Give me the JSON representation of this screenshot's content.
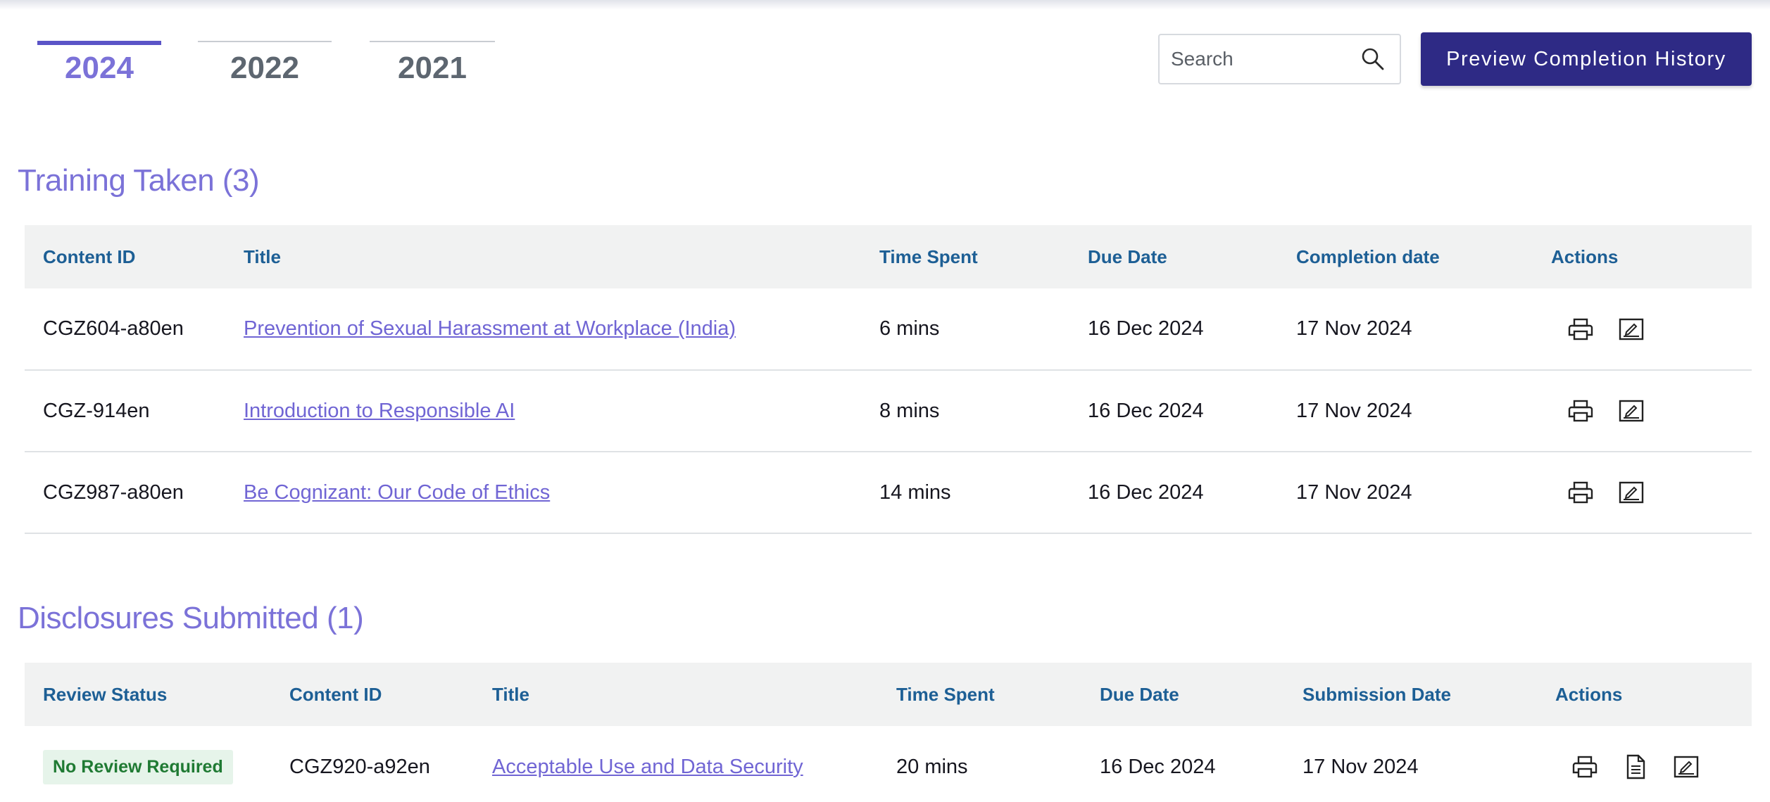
{
  "tabs": [
    {
      "label": "2024",
      "active": true
    },
    {
      "label": "2022",
      "active": false
    },
    {
      "label": "2021",
      "active": false
    }
  ],
  "search": {
    "placeholder": "Search",
    "value": "",
    "icon": "search-icon"
  },
  "preview_button": {
    "label": "Preview Completion History"
  },
  "colors": {
    "accent": "#7b72d8",
    "primary": "#2e2a85",
    "header_text": "#1d5f95",
    "badge_bg": "#e6f4ea",
    "badge_text": "#1f7a33"
  },
  "training": {
    "title": "Training Taken (3)",
    "columns": [
      "Content ID",
      "Title",
      "Time Spent",
      "Due Date",
      "Completion date",
      "Actions"
    ],
    "rows": [
      {
        "content_id": "CGZ604-a80en",
        "title": "Prevention of Sexual Harassment at Workplace (India)",
        "time_spent": "6 mins",
        "due_date": "16 Dec 2024",
        "completion_date": "17 Nov 2024",
        "actions": [
          "print-icon",
          "signature-icon"
        ]
      },
      {
        "content_id": "CGZ-914en",
        "title": "Introduction to Responsible AI",
        "time_spent": "8 mins",
        "due_date": "16 Dec 2024",
        "completion_date": "17 Nov 2024",
        "actions": [
          "print-icon",
          "signature-icon"
        ]
      },
      {
        "content_id": "CGZ987-a80en",
        "title": "Be Cognizant: Our Code of Ethics",
        "time_spent": "14 mins",
        "due_date": "16 Dec 2024",
        "completion_date": "17 Nov 2024",
        "actions": [
          "print-icon",
          "signature-icon"
        ]
      }
    ]
  },
  "disclosures": {
    "title": "Disclosures Submitted (1)",
    "columns": [
      "Review Status",
      "Content ID",
      "Title",
      "Time Spent",
      "Due Date",
      "Submission Date",
      "Actions"
    ],
    "rows": [
      {
        "review_status": "No Review Required",
        "content_id": "CGZ920-a92en",
        "title": "Acceptable Use and Data Security",
        "time_spent": "20 mins",
        "due_date": "16 Dec 2024",
        "submission_date": "17 Nov 2024",
        "actions": [
          "print-icon",
          "document-icon",
          "signature-icon"
        ]
      }
    ]
  }
}
